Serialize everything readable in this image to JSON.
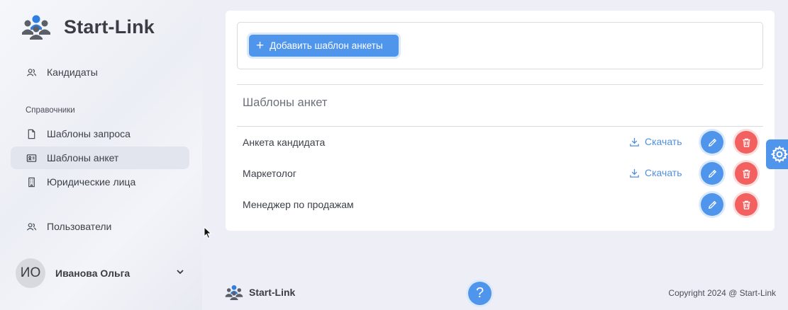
{
  "brand": {
    "name": "Start-Link",
    "logo": "people-group-icon",
    "accent": "#4f95ec"
  },
  "sidebar": {
    "items": [
      {
        "label": "Кандидаты",
        "icon": "users-icon"
      },
      {
        "label": "Шаблоны запроса",
        "icon": "file-icon"
      },
      {
        "label": "Шаблоны анкет",
        "icon": "id-card-icon",
        "active": true
      },
      {
        "label": "Юридические лица",
        "icon": "building-icon"
      },
      {
        "label": "Пользователи",
        "icon": "users-icon"
      }
    ],
    "section_label": "Справочники"
  },
  "user": {
    "initials": "ИО",
    "name": "Иванова Ольга"
  },
  "toolbar": {
    "add_label": "Добавить шаблон анкеты"
  },
  "main": {
    "title": "Шаблоны анкет",
    "download_label": "Скачать",
    "rows": [
      {
        "name": "Анкета кандидата",
        "has_download": true
      },
      {
        "name": "Маркетолог",
        "has_download": true
      },
      {
        "name": "Менеджер по продажам",
        "has_download": false
      }
    ]
  },
  "footer": {
    "brand": "Start-Link",
    "copyright": "Copyright 2024 @ Start-Link"
  },
  "colors": {
    "primary": "#4f95ec",
    "danger": "#f26060",
    "link": "#4f8fe0"
  }
}
